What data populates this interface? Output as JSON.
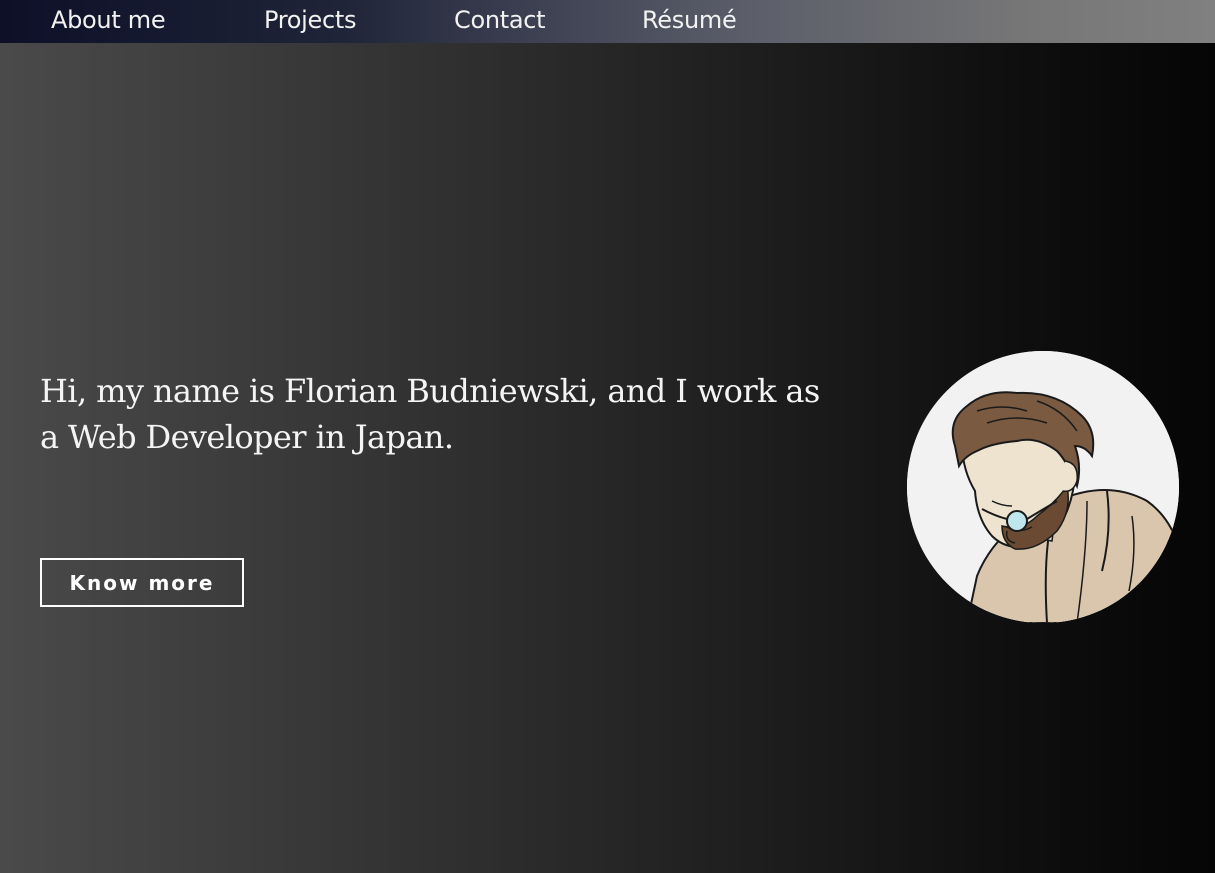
{
  "nav": {
    "about": "About me",
    "projects": "Projects",
    "contact": "Contact",
    "resume": "Résumé"
  },
  "hero": {
    "intro": "Hi, my name is Florian Budniewski, and I work as a Web Developer in Japan.",
    "button_label": "Know more"
  },
  "avatar": {
    "icon": "portrait-illustration"
  },
  "colors": {
    "nav_start": "#0d1028",
    "nav_end": "#808080",
    "background_left": "#4a4a4a",
    "background_right": "#050505"
  }
}
